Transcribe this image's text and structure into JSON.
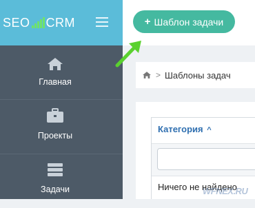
{
  "logo": {
    "part1": "SEO",
    "part2": "CRM",
    "icon": "signal-bars-icon"
  },
  "sidebar": {
    "items": [
      {
        "label": "Главная",
        "icon": "home-icon"
      },
      {
        "label": "Проекты",
        "icon": "briefcase-icon"
      },
      {
        "label": "Задачи",
        "icon": "tasks-icon"
      }
    ]
  },
  "toolbar": {
    "add_label": "Шаблон задачи",
    "add_icon": "plus-icon"
  },
  "breadcrumb": {
    "home_icon": "home-icon",
    "separator": ">",
    "current": "Шаблоны задач"
  },
  "table": {
    "column_header": "Категория",
    "sort_indicator": "^",
    "filter_value": "",
    "empty_text": "Ничего не найдено"
  },
  "watermark": "WFNEX.RU",
  "colors": {
    "sidebar": "#4d5a67",
    "logo_bar": "#5bbcd9",
    "button": "#45b9a0",
    "link": "#2f6fb0",
    "arrow": "#5ad12f"
  }
}
